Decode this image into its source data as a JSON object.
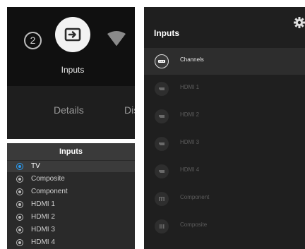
{
  "launcher": {
    "source_number": "2",
    "selected_label": "Inputs",
    "bottom_items": [
      "Details",
      "Dis"
    ]
  },
  "inputs_menu": {
    "title": "Inputs",
    "options": [
      "TV",
      "Composite",
      "Component",
      "HDMI 1",
      "HDMI 2",
      "HDMI 3",
      "HDMI 4"
    ],
    "selected": "TV",
    "accent_color": "#2a9df4"
  },
  "inputs_panel": {
    "title": "Inputs",
    "settings_icon": "gear-icon",
    "items": [
      {
        "label": "Channels",
        "icon": "channels-icon"
      },
      {
        "label": "HDMI 1",
        "icon": "hdmi-icon"
      },
      {
        "label": "HDMI 2",
        "icon": "hdmi-icon"
      },
      {
        "label": "HDMI 3",
        "icon": "hdmi-icon"
      },
      {
        "label": "HDMI 4",
        "icon": "hdmi-icon"
      },
      {
        "label": "Component",
        "icon": "component-icon"
      },
      {
        "label": "Composite",
        "icon": "composite-icon"
      }
    ],
    "focused": "Channels"
  }
}
